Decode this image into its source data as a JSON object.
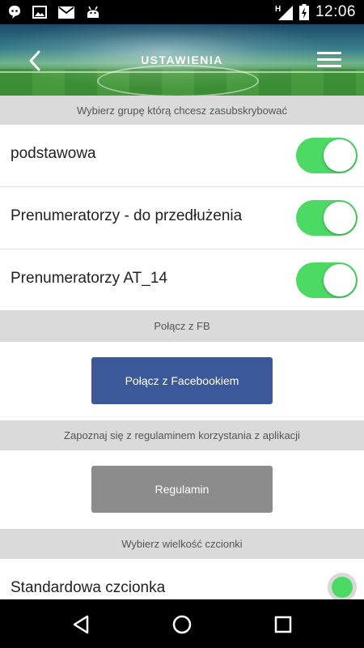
{
  "status_bar": {
    "time": "12:06",
    "left_icons": [
      "chat-bubble-icon",
      "image-icon",
      "mail-icon",
      "android-icon"
    ],
    "right_icons": [
      "signal-h-icon",
      "battery-charging-icon"
    ]
  },
  "header": {
    "title": "USTAWIENIA",
    "back_icon": "chevron-left-icon",
    "menu_icon": "hamburger-menu-icon"
  },
  "subscription": {
    "section_label": "Wybierz grupę którą chcesz zasubskrybować",
    "groups": [
      {
        "label": "podstawowa",
        "enabled": true
      },
      {
        "label": "Prenumeratorzy - do przedłużenia",
        "enabled": true
      },
      {
        "label": "Prenumeratorzy AT_14",
        "enabled": true
      }
    ]
  },
  "facebook": {
    "section_label": "Połącz z FB",
    "button_label": "Połącz z Facebookiem"
  },
  "terms": {
    "section_label": "Zapoznaj się z regulaminem korzystania z aplikacji",
    "button_label": "Regulamin"
  },
  "font_size": {
    "section_label": "Wybierz wielkość czcionki",
    "options": [
      {
        "label": "Standardowa czcionka",
        "selected": true
      }
    ]
  },
  "colors": {
    "toggle_on": "#4cd964",
    "facebook_button": "#3b5998",
    "terms_button": "#8c8c8c",
    "section_header_bg": "#dadada"
  },
  "nav_bar": {
    "icons": [
      "back-triangle-icon",
      "home-circle-icon",
      "recents-square-icon"
    ]
  }
}
